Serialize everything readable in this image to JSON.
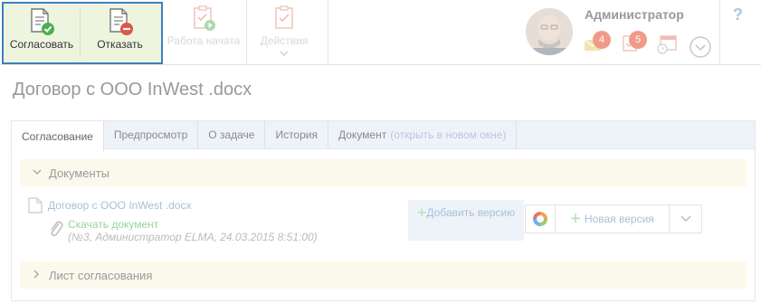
{
  "toolbar": {
    "approve_label": "Согласовать",
    "reject_label": "Отказать",
    "work_started_label": "Работа начата",
    "actions_label": "Действия"
  },
  "user": {
    "name": "Администратор",
    "mail_count": "4",
    "tasks_count": "5"
  },
  "help_label": "?",
  "page": {
    "title": "Договор с ООО InWest .docx"
  },
  "tabs": [
    {
      "label": "Согласование"
    },
    {
      "label": "Предпросмотр"
    },
    {
      "label": "О задаче"
    },
    {
      "label": "История"
    },
    {
      "label": "Документ",
      "link": "(открыть в новом окне)"
    }
  ],
  "sections": {
    "documents": "Документы",
    "approval_sheet": "Лист согласования"
  },
  "document": {
    "name": "Договор с ООО InWest .docx",
    "download_label": "Скачать документ",
    "meta": "(№3, Администратор ELMA, 24.03.2015 8:51:00)"
  },
  "buttons": {
    "add_version": "Добавить версию",
    "new_version": "Новая версия"
  },
  "colors": {
    "highlight_border": "#3d7fc1",
    "approve_green": "#4caf50",
    "reject_red": "#e05547",
    "badge": "#f19a8a"
  }
}
